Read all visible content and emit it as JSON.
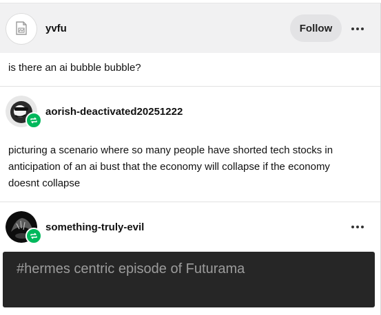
{
  "header": {
    "username": "yvfu",
    "follow_label": "Follow"
  },
  "post": {
    "body": "is there an ai bubble bubble?"
  },
  "reblogs": [
    {
      "username": "aorish-deactivated20251222",
      "body_lines": [
        "picturing a scenario where so many people have shorted tech stocks in",
        "anticipation of an ai bust that the economy will collapse if the economy",
        "doesnt collapse"
      ]
    },
    {
      "username": "something-truly-evil"
    }
  ],
  "tags": {
    "items": [
      "#hermes centric episode of Futurama"
    ]
  },
  "colors": {
    "header_bg": "#f1f1f2",
    "reblog_badge": "#00b85c",
    "tags_bg": "#262626",
    "tag_text": "#9c9c9c"
  },
  "icons": {
    "header_avatar": "image-placeholder-icon",
    "more": "ellipsis-icon",
    "reblog": "reblog-icon"
  }
}
